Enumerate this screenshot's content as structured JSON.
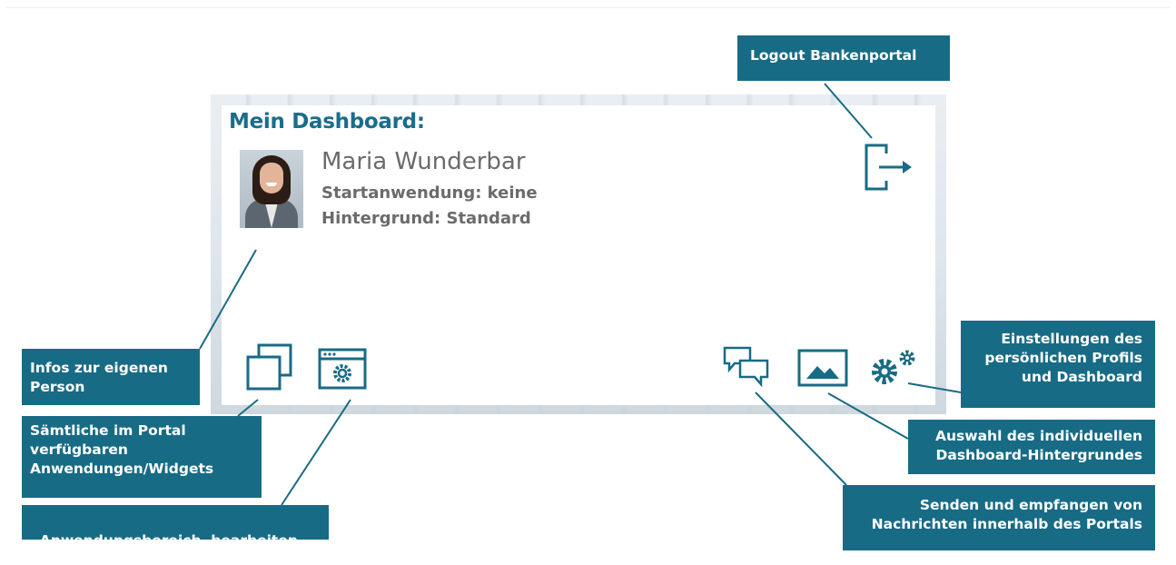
{
  "dashboard": {
    "title": "Mein Dashboard:",
    "user": {
      "name": "Maria Wunderbar",
      "start_app": "Startanwendung: keine",
      "background": "Hintergrund: Standard"
    },
    "icons": {
      "logout": "logout-icon",
      "widgets": "windows-stack-icon",
      "edit_area": "app-settings-icon",
      "messages": "chat-bubbles-icon",
      "background": "image-icon",
      "settings": "gears-icon"
    }
  },
  "callouts": {
    "logout": "Logout Bankenportal",
    "person": [
      "Infos zur eigenen",
      "Person"
    ],
    "widgets": [
      "Sämtliche im Portal",
      "verfügbaren",
      "Anwendungen/Widgets"
    ],
    "edit_area": "Anwendungsbereich  bearbeiten",
    "settings": [
      "Einstellungen des",
      "persönlichen Profils",
      "und Dashboard"
    ],
    "background": [
      "Auswahl des individuellen",
      "Dashboard-Hintergrundes"
    ],
    "messages": [
      "Senden und empfangen von",
      "Nachrichten innerhalb des Portals"
    ]
  },
  "colors": {
    "accent": "#186b85",
    "title": "#1a6d8b",
    "text": "#6b6b6b"
  }
}
